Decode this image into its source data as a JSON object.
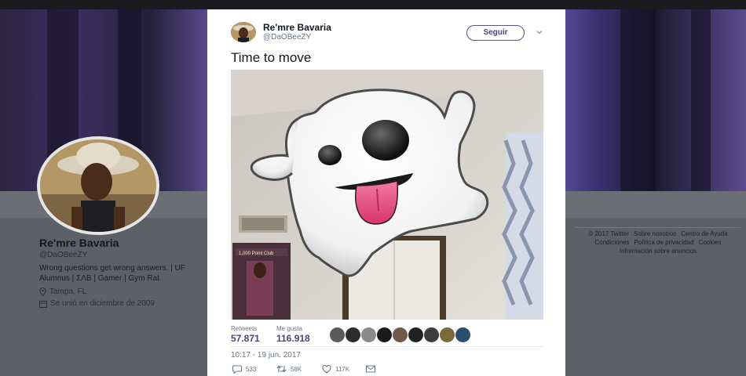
{
  "profile": {
    "name": "Re'mre Bavaria",
    "handle": "@DaOBeeZY",
    "bio": "Wrong questions get wrong answers. | UF Alumnus | ΣΛΒ | Gamer | Gym Rat",
    "location": "Tampa, FL",
    "joined": "Se unió en diciembre de 2009"
  },
  "footer": {
    "links": [
      "© 2017 Twitter",
      "Sobre nosotros",
      "Centro de Ayuda",
      "Condiciones",
      "Política de privacidad",
      "Cookies",
      "Información sobre anuncios"
    ]
  },
  "tweet": {
    "author_name": "Re'mre Bavaria",
    "author_handle": "@DaOBeeZY",
    "follow_label": "Seguir",
    "text": "Time to move",
    "poster_text": "1,000 Point Club",
    "retweets_label": "Retweets",
    "retweets_count": "57.871",
    "likes_label": "Me gusta",
    "likes_count": "116.918",
    "timestamp": "10:17 - 19 jun. 2017",
    "reply_count": "533",
    "retweet_short": "58K",
    "like_short": "117K"
  },
  "icons": [
    "location-pin-icon",
    "calendar-icon",
    "chevron-down-icon",
    "reply-icon",
    "retweet-icon",
    "heart-icon",
    "message-icon",
    "ghost-emoji"
  ],
  "colors": {
    "accent": "#4b3f7c",
    "muted": "#657786",
    "ghost_tongue": "#e0457b"
  }
}
